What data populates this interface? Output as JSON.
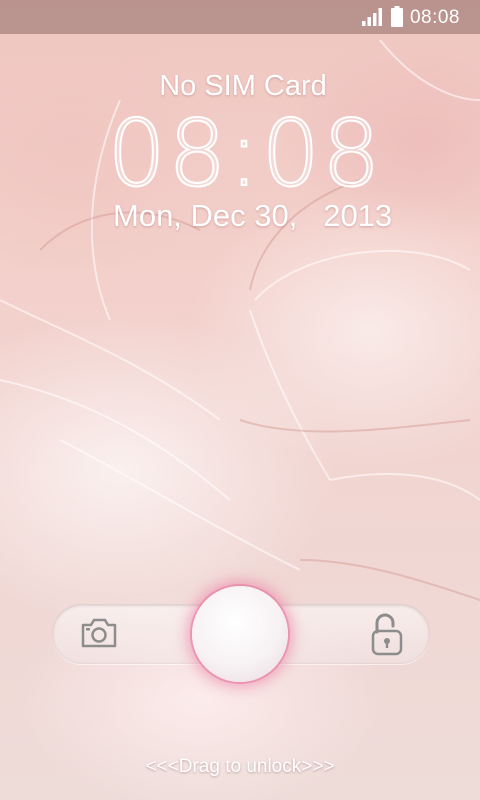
{
  "status_bar": {
    "time": "08:08",
    "icons": [
      "signal-icon",
      "battery-icon"
    ]
  },
  "lockscreen": {
    "carrier": "No SIM Card",
    "clock": "08:08",
    "date": "Mon, Dec 30,   2013",
    "unlock_hint": "<<<Drag to unlock>>>",
    "slider_icons": [
      "camera-icon",
      "unlock-icon"
    ]
  },
  "colors": {
    "knob_glow": "#eb6e9b",
    "text": "#ffffff"
  }
}
